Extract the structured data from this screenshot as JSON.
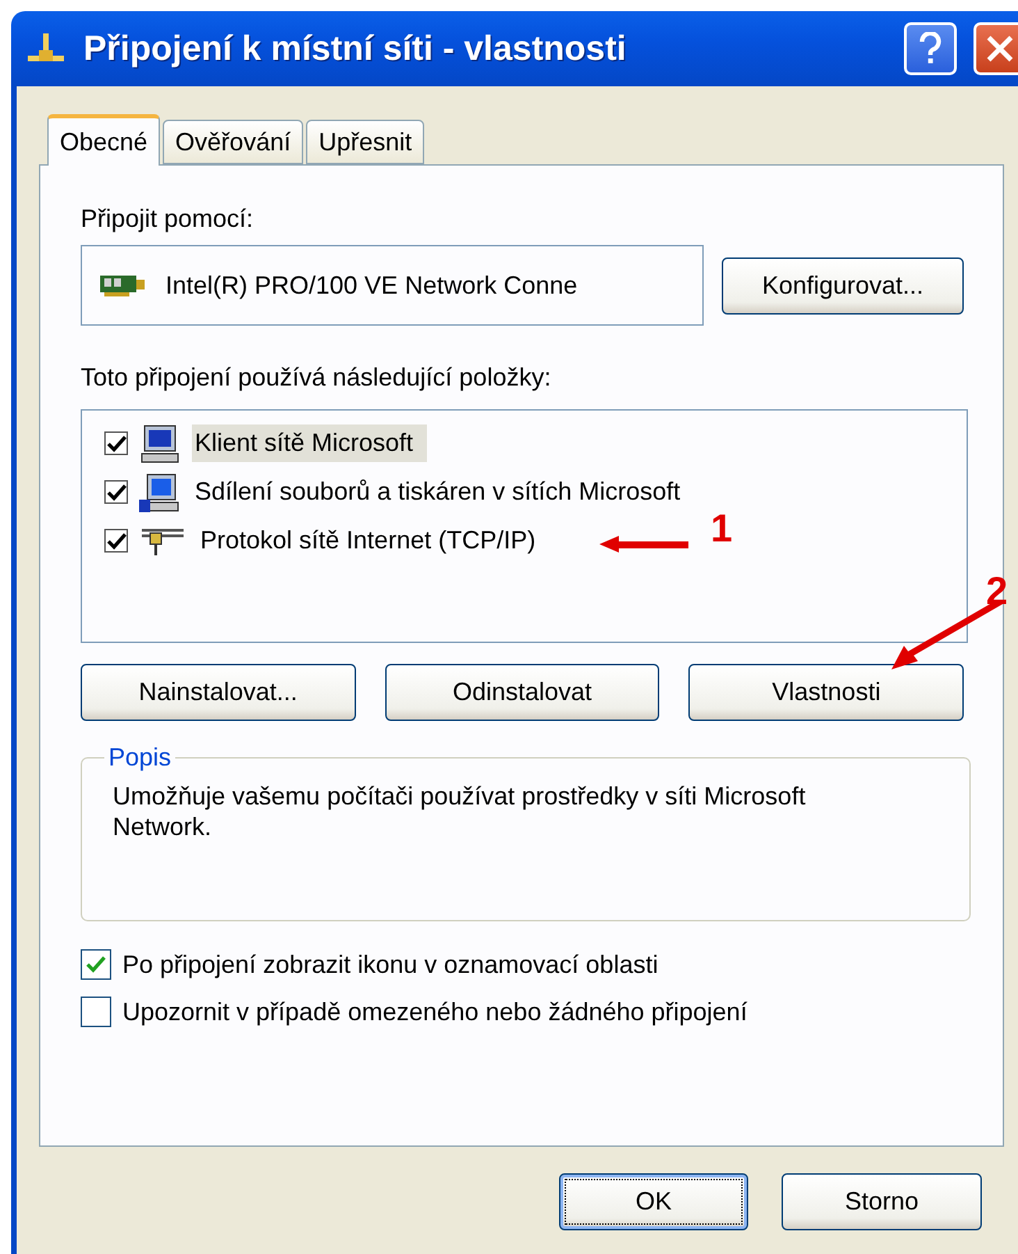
{
  "window": {
    "title": "Připojení k místní síti - vlastnosti"
  },
  "tabs": [
    {
      "label": "Obecné",
      "selected": true
    },
    {
      "label": "Ověřování",
      "selected": false
    },
    {
      "label": "Upřesnit",
      "selected": false
    }
  ],
  "connect_using": {
    "label": "Připojit pomocí:",
    "adapter": "Intel(R) PRO/100 VE Network Conne",
    "button": "Konfigurovat..."
  },
  "items": {
    "label": "Toto připojení používá následující položky:",
    "rows": [
      {
        "label": "Klient sítě Microsoft",
        "checked": true,
        "selected": true,
        "kind": "client"
      },
      {
        "label": "Sdílení souborů a tiskáren v sítích Microsoft",
        "checked": true,
        "selected": false,
        "kind": "service"
      },
      {
        "label": "Protokol sítě Internet (TCP/IP)",
        "checked": true,
        "selected": false,
        "kind": "protocol"
      }
    ]
  },
  "item_buttons": [
    "Nainstalovat...",
    "Odinstalovat",
    "Vlastnosti"
  ],
  "description": {
    "legend": "Popis",
    "text": "Umožňuje vašemu počítači používat prostředky v síti Microsoft Network."
  },
  "options": [
    {
      "label": "Po připojení zobrazit ikonu v oznamovací oblasti",
      "checked": true
    },
    {
      "label": "Upozornit v případě omezeného nebo žádného připojení",
      "checked": false
    }
  ],
  "dialog_buttons": [
    {
      "label": "OK",
      "selected": true
    },
    {
      "label": "Storno",
      "selected": false
    }
  ],
  "annotations": [
    {
      "label": "1"
    },
    {
      "label": "2"
    }
  ]
}
